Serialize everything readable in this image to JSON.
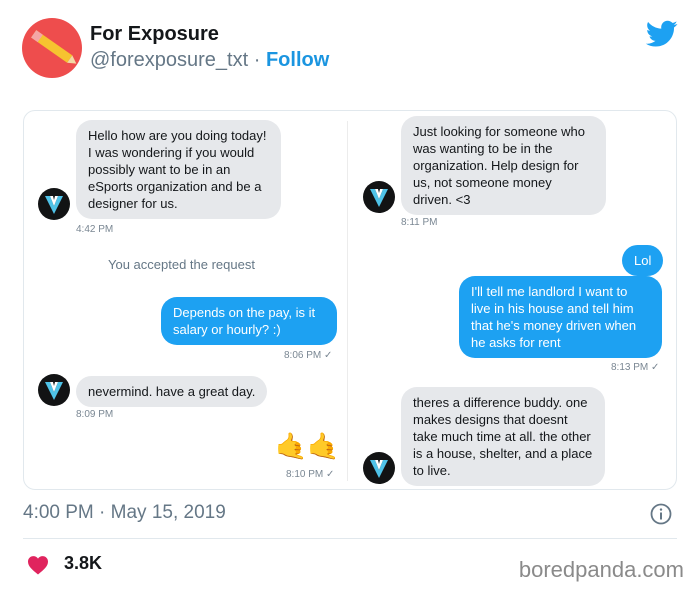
{
  "tweet": {
    "display_name": "For Exposure",
    "handle": "@forexposure_txt",
    "separator": "·",
    "follow_label": "Follow",
    "timestamp": "4:00 PM · May 15, 2019",
    "likes": "3.8K",
    "brand_color": "#1da1f2",
    "avatar_color": "#ee4d4d"
  },
  "conversation": {
    "left": {
      "msg1": "Hello how are you doing today! I was wondering if you would possibly want to be in an eSports organization and be a designer for us.",
      "time1": "4:42 PM",
      "system": "You accepted the request",
      "msg2": "Depends on the pay, is it salary or hourly? :)",
      "time2": "8:06 PM ✓",
      "msg3": "nevermind. have a great day.",
      "time3": "8:09 PM",
      "msg4": "🤙🤙",
      "time4": "8:10 PM ✓"
    },
    "right": {
      "msg1": "Just looking for someone who was wanting to be in the organization. Help design for us, not someone money driven. <3",
      "time1": "8:11 PM",
      "msg2": "Lol",
      "msg3": "I'll tell me landlord I want to live in his house and tell him that he's money driven when he asks for rent",
      "time3": "8:13 PM ✓",
      "msg4": "theres a difference buddy. one makes designs that doesnt take much time at all. the other is a house, shelter, and a place to live."
    }
  },
  "watermark": "boredpanda.com"
}
